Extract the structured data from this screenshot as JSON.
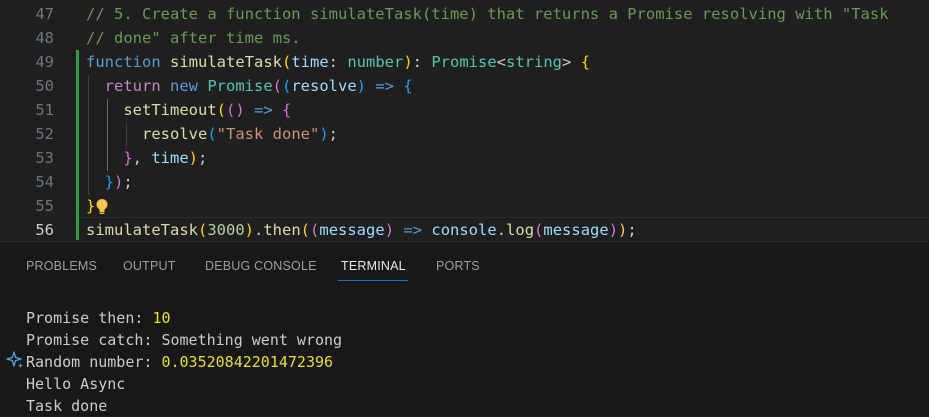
{
  "editor": {
    "lines": [
      {
        "num": "47",
        "tokens": [
          {
            "t": "// 5. Create a function simulateTask(time) that returns a Promise resolving with \"Task",
            "c": "c-comment"
          }
        ]
      },
      {
        "num": "48",
        "tokens": [
          {
            "t": "// done\" after time ms.",
            "c": "c-comment"
          }
        ]
      },
      {
        "num": "49",
        "tokens": [
          {
            "t": "function ",
            "c": "c-kw"
          },
          {
            "t": "simulateTask",
            "c": "c-fn"
          },
          {
            "t": "(",
            "c": "c-p1"
          },
          {
            "t": "time",
            "c": "c-param"
          },
          {
            "t": ": ",
            "c": "c-plain"
          },
          {
            "t": "number",
            "c": "c-type"
          },
          {
            "t": ")",
            "c": "c-p1"
          },
          {
            "t": ": ",
            "c": "c-plain"
          },
          {
            "t": "Promise",
            "c": "c-type"
          },
          {
            "t": "<",
            "c": "c-plain"
          },
          {
            "t": "string",
            "c": "c-type"
          },
          {
            "t": "> ",
            "c": "c-plain"
          },
          {
            "t": "{",
            "c": "c-p1"
          }
        ]
      },
      {
        "num": "50",
        "tokens": [
          {
            "t": "  return ",
            "c": "c-ctrl"
          },
          {
            "t": "new ",
            "c": "c-kw"
          },
          {
            "t": "Promise",
            "c": "c-type"
          },
          {
            "t": "(",
            "c": "c-p2"
          },
          {
            "t": "(",
            "c": "c-p3"
          },
          {
            "t": "resolve",
            "c": "c-param"
          },
          {
            "t": ") ",
            "c": "c-p3"
          },
          {
            "t": "=> ",
            "c": "c-kw"
          },
          {
            "t": "{",
            "c": "c-p3"
          }
        ]
      },
      {
        "num": "51",
        "tokens": [
          {
            "t": "    setTimeout",
            "c": "c-fn"
          },
          {
            "t": "(",
            "c": "c-p1"
          },
          {
            "t": "() ",
            "c": "c-p2"
          },
          {
            "t": "=> ",
            "c": "c-kw"
          },
          {
            "t": "{",
            "c": "c-p2"
          }
        ]
      },
      {
        "num": "52",
        "tokens": [
          {
            "t": "      resolve",
            "c": "c-fn"
          },
          {
            "t": "(",
            "c": "c-p3"
          },
          {
            "t": "\"Task done\"",
            "c": "c-str"
          },
          {
            "t": ")",
            "c": "c-p3"
          },
          {
            "t": ";",
            "c": "c-plain"
          }
        ]
      },
      {
        "num": "53",
        "tokens": [
          {
            "t": "    }",
            "c": "c-p2"
          },
          {
            "t": ", ",
            "c": "c-plain"
          },
          {
            "t": "time",
            "c": "c-param"
          },
          {
            "t": ")",
            "c": "c-p1"
          },
          {
            "t": ";",
            "c": "c-plain"
          }
        ]
      },
      {
        "num": "54",
        "tokens": [
          {
            "t": "  }",
            "c": "c-p3"
          },
          {
            "t": ")",
            "c": "c-p2"
          },
          {
            "t": ";",
            "c": "c-plain"
          }
        ]
      },
      {
        "num": "55",
        "tokens": [
          {
            "t": "}",
            "c": "c-p1"
          }
        ],
        "bulb": true
      },
      {
        "num": "56",
        "active": true,
        "tokens": [
          {
            "t": "simulateTask",
            "c": "c-fn"
          },
          {
            "t": "(",
            "c": "c-p1"
          },
          {
            "t": "3000",
            "c": "c-num"
          },
          {
            "t": ")",
            "c": "c-p1"
          },
          {
            "t": ".",
            "c": "c-plain"
          },
          {
            "t": "then",
            "c": "c-fn"
          },
          {
            "t": "(",
            "c": "c-p1"
          },
          {
            "t": "(",
            "c": "c-p2"
          },
          {
            "t": "message",
            "c": "c-param"
          },
          {
            "t": ") ",
            "c": "c-p2"
          },
          {
            "t": "=> ",
            "c": "c-kw"
          },
          {
            "t": "console",
            "c": "c-param"
          },
          {
            "t": ".",
            "c": "c-plain"
          },
          {
            "t": "log",
            "c": "c-fn"
          },
          {
            "t": "(",
            "c": "c-p2"
          },
          {
            "t": "message",
            "c": "c-param"
          },
          {
            "t": ")",
            "c": "c-p2"
          },
          {
            "t": ")",
            "c": "c-p1"
          },
          {
            "t": ";",
            "c": "c-plain"
          }
        ]
      }
    ]
  },
  "panel": {
    "tabs": [
      {
        "label": "PROBLEMS"
      },
      {
        "label": "OUTPUT"
      },
      {
        "label": "DEBUG CONSOLE"
      },
      {
        "label": "TERMINAL",
        "active": true
      },
      {
        "label": "PORTS"
      }
    ]
  },
  "terminal": {
    "lines": [
      {
        "text": "Promise then: ",
        "num": "10"
      },
      {
        "text": "Promise catch: Something went wrong"
      },
      {
        "text": "Random number: ",
        "num": "0.03520842201472396"
      },
      {
        "text": "Hello Async"
      },
      {
        "text": "Task done"
      }
    ]
  },
  "colors": {
    "background": "#1f1f1f",
    "modified_gutter": "#2ea043",
    "active_tab_underline": "#0078d4",
    "terminal_number": "#e5e510"
  },
  "icons": [
    "lightbulb-icon",
    "sparkle-icon"
  ]
}
